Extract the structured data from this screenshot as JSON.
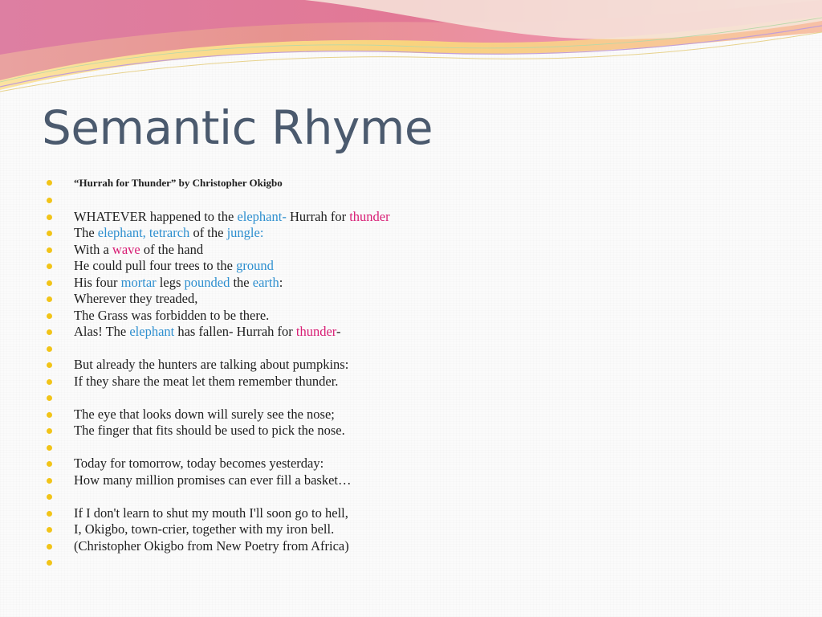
{
  "slide": {
    "title": "Semantic Rhyme",
    "accent_colors": {
      "title": "#4b5a6e",
      "bullet": "#f2c418",
      "keyword_blue": "#2e8fcf",
      "keyword_pink": "#d81d74"
    }
  },
  "poem": {
    "heading": "“Hurrah for Thunder” by Christopher Okigbo",
    "lines": [
      [],
      [
        {
          "t": "WHATEVER happened to the "
        },
        {
          "t": "elephant-",
          "c": "blue"
        },
        {
          "t": " Hurrah for "
        },
        {
          "t": "thunder",
          "c": "pink"
        }
      ],
      [
        {
          "t": "The "
        },
        {
          "t": "elephant, tetrarch",
          "c": "blue"
        },
        {
          "t": " of the "
        },
        {
          "t": "jungle:",
          "c": "blue"
        }
      ],
      [
        {
          "t": "With a "
        },
        {
          "t": "wave",
          "c": "pink"
        },
        {
          "t": " of the hand"
        }
      ],
      [
        {
          "t": "He could pull four trees to the "
        },
        {
          "t": "ground",
          "c": "blue"
        }
      ],
      [
        {
          "t": "His four "
        },
        {
          "t": "mortar",
          "c": "blue"
        },
        {
          "t": " legs "
        },
        {
          "t": "pounded",
          "c": "blue"
        },
        {
          "t": " the "
        },
        {
          "t": "earth",
          "c": "blue"
        },
        {
          "t": ":"
        }
      ],
      [
        {
          "t": "Wherever they treaded,"
        }
      ],
      [
        {
          "t": "The Grass was forbidden to be there."
        }
      ],
      [
        {
          "t": "Alas! The "
        },
        {
          "t": "elephant",
          "c": "blue"
        },
        {
          "t": " has fallen- Hurrah for "
        },
        {
          "t": "thunder",
          "c": "pink"
        },
        {
          "t": "-"
        }
      ],
      [],
      [
        {
          "t": "But already the hunters are talking about pumpkins:"
        }
      ],
      [
        {
          "t": "If they share the meat let them remember thunder."
        }
      ],
      [],
      [
        {
          "t": "The eye that looks down will surely see the nose;"
        }
      ],
      [
        {
          "t": "The finger that fits should be used to pick the nose."
        }
      ],
      [],
      [
        {
          "t": "Today for tomorrow, today becomes yesterday:"
        }
      ],
      [
        {
          "t": "How many million promises can ever fill a basket…"
        }
      ],
      [],
      [
        {
          "t": "If I don't learn to shut my mouth I'll soon go to hell,"
        }
      ],
      [
        {
          "t": "I, Okigbo, town-crier, together with my iron bell."
        }
      ],
      [
        {
          "t": "(Christopher Okigbo from New Poetry from Africa)"
        }
      ],
      []
    ]
  }
}
